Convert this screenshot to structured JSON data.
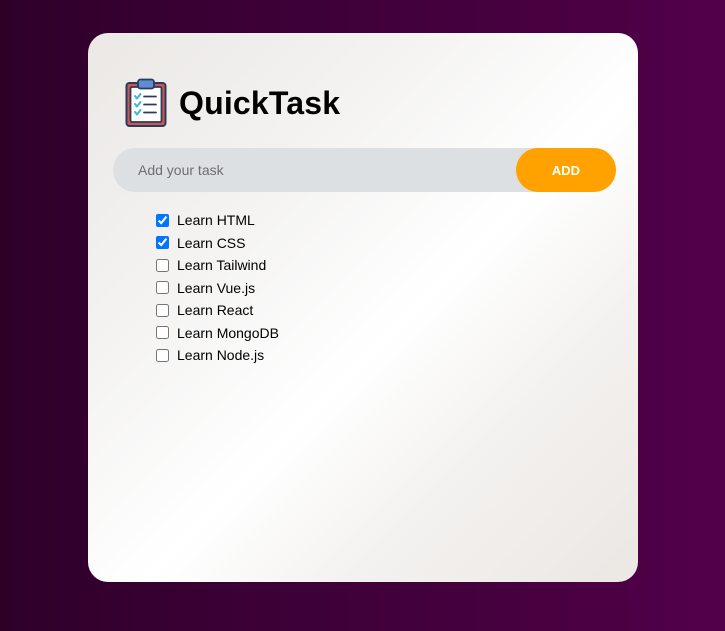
{
  "app": {
    "title": "QuickTask",
    "logo_icon": "clipboard-checklist-icon"
  },
  "input": {
    "placeholder": "Add your task",
    "value": ""
  },
  "add_button": {
    "label": "ADD",
    "color": "#ffa200"
  },
  "tasks": [
    {
      "label": "Learn HTML",
      "checked": true
    },
    {
      "label": "Learn CSS",
      "checked": true
    },
    {
      "label": "Learn Tailwind",
      "checked": false
    },
    {
      "label": "Learn Vue.js",
      "checked": false
    },
    {
      "label": "Learn React",
      "checked": false
    },
    {
      "label": "Learn MongoDB",
      "checked": false
    },
    {
      "label": "Learn Node.js",
      "checked": false
    }
  ]
}
